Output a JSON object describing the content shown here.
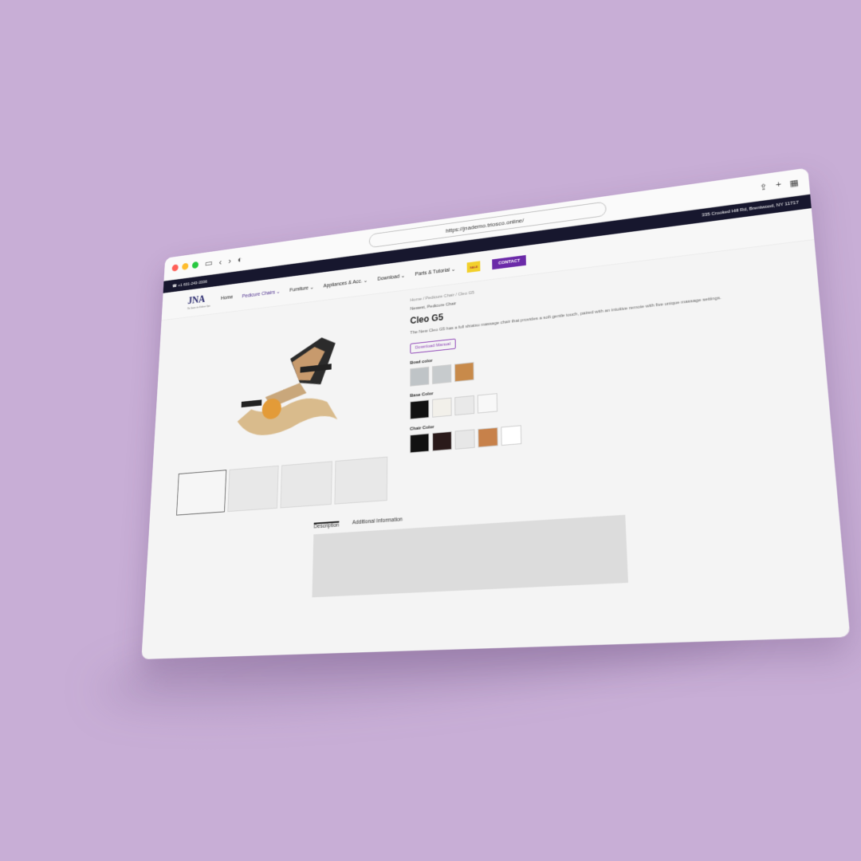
{
  "browser": {
    "url": "https://jnademo.triosco.online/"
  },
  "topbar": {
    "phone": "☎ +1 631-243-3336",
    "address": "335 Crooked Hill Rd, Brentwood, NY 11717"
  },
  "nav": {
    "logo_text": "JNA",
    "logo_sub": "The Source for Pedicure Spas",
    "items": [
      {
        "label": "Home"
      },
      {
        "label": "Pedicure Chairs ⌄"
      },
      {
        "label": "Furniture ⌄"
      },
      {
        "label": "Appliances & Acc. ⌄"
      },
      {
        "label": "Download ⌄"
      },
      {
        "label": "Parts & Tutorial ⌄"
      }
    ],
    "badge": "SALE",
    "contact": "CONTACT"
  },
  "product": {
    "breadcrumb": "Home / Pedicure Chair / Cleo G5",
    "categories": "Newest, Pedicure Chair",
    "title": "Cleo G5",
    "description": "The New Cleo G5 has a full shiatsu massage chair that provides a soft gentle touch, paired with an intuitive remote with five unique massage settings.",
    "download_manual": "Download Manual",
    "bowl_color_label": "Bowl color",
    "base_color_label": "Base Color",
    "chair_color_label": "Chair Color"
  },
  "colors": {
    "bowl": [
      "#bfc4c7",
      "#c7cbcd",
      "#c88a4a"
    ],
    "base": [
      "#111111",
      "#f2f0ea",
      "#e9e9e9",
      "#f8f8f8"
    ],
    "chair": [
      "#111111",
      "#2a1a1a",
      "#e7e7e7",
      "#c7814a",
      "#ffffff"
    ]
  },
  "tabs": {
    "description": "Description",
    "additional": "Additional Information"
  }
}
